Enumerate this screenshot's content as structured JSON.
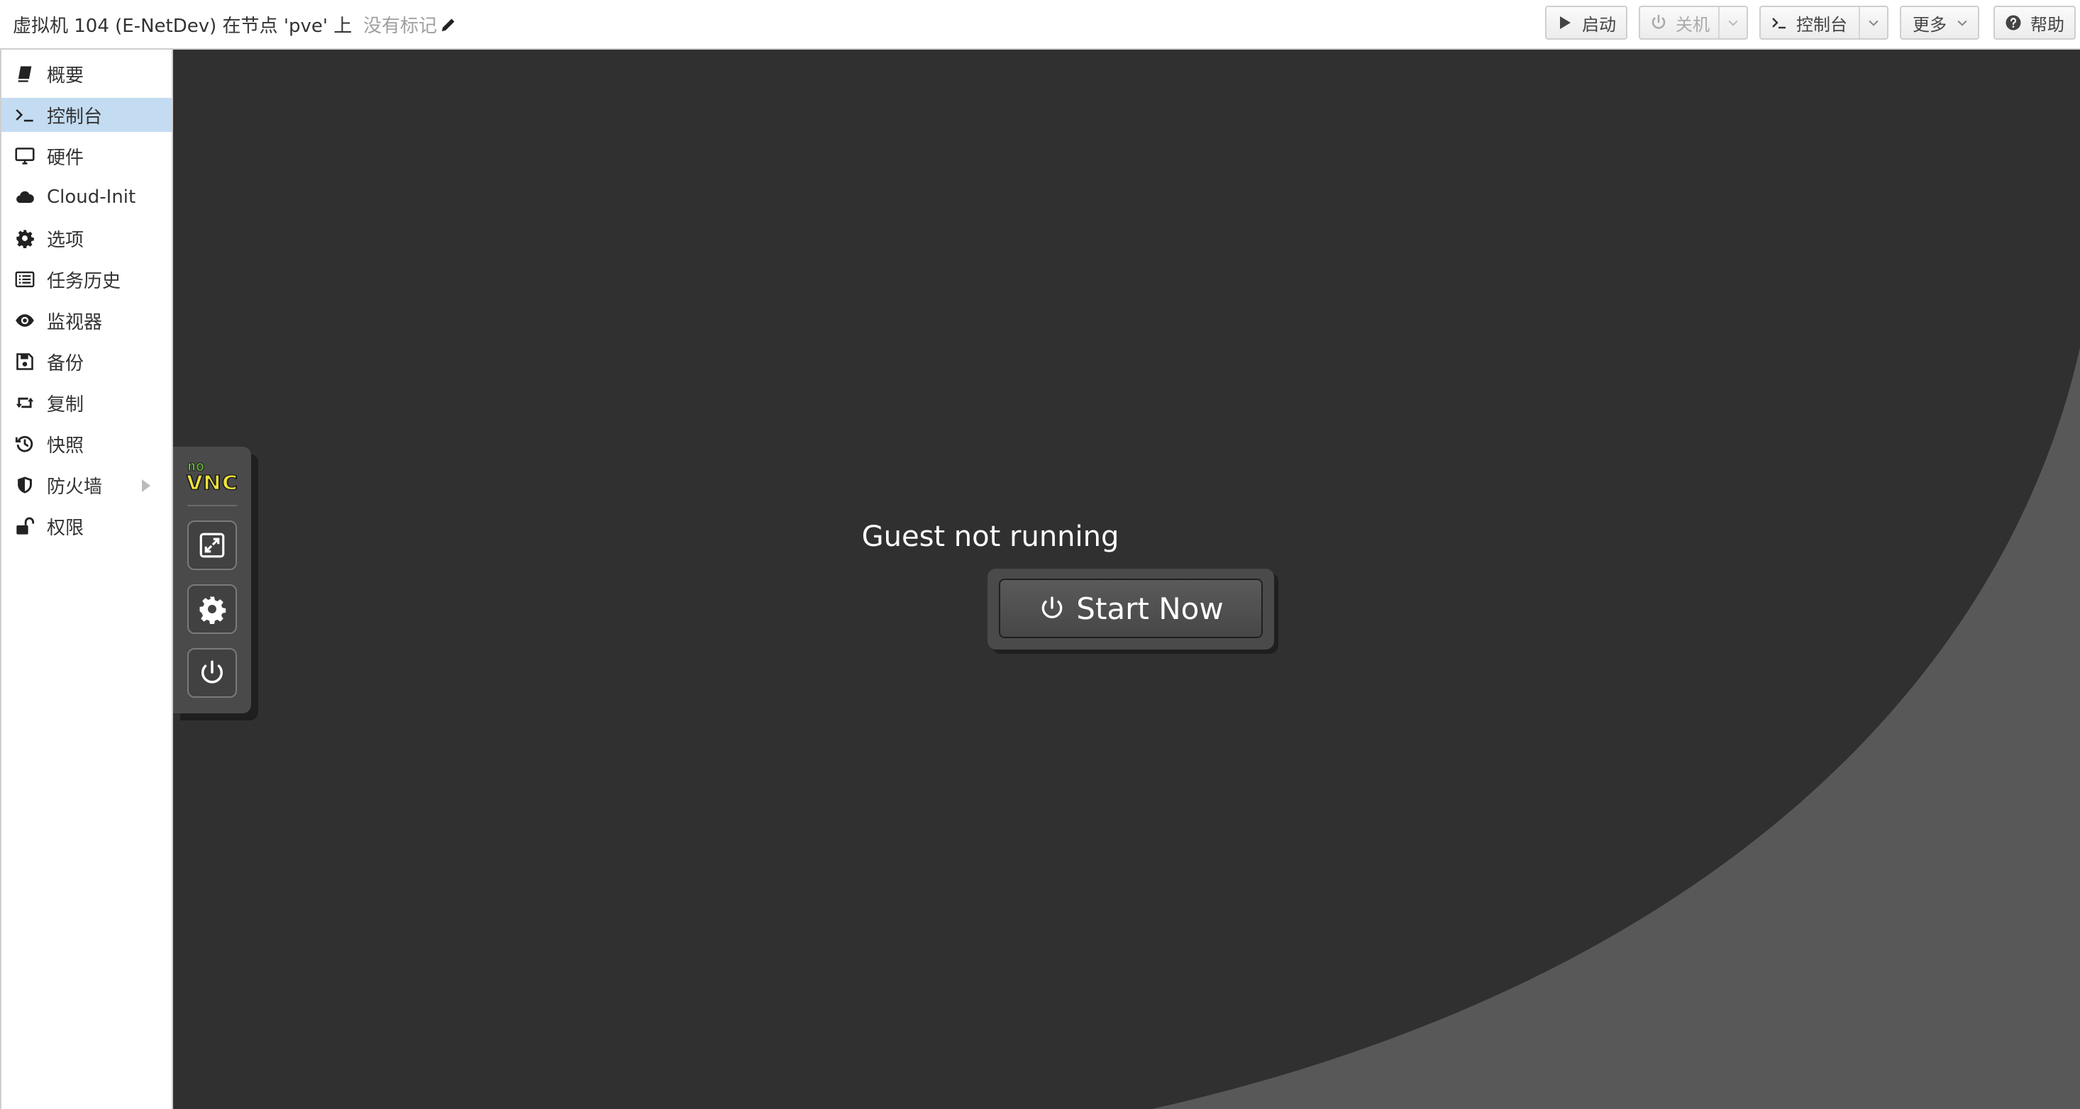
{
  "header": {
    "title": "虚拟机 104 (E-NetDev) 在节点 'pve' 上",
    "tags_placeholder": "没有标记",
    "tags_icon": "pencil-icon",
    "buttons": {
      "start": {
        "label": "启动",
        "icon": "play-icon"
      },
      "shutdown": {
        "label": "关机",
        "icon": "power-icon"
      },
      "console": {
        "label": "控制台",
        "icon": "terminal-icon"
      },
      "more": {
        "label": "更多",
        "icon": "chevron-down-icon"
      },
      "help": {
        "label": "帮助",
        "icon": "question-circle-icon"
      }
    }
  },
  "sidebar": {
    "active": "控制台",
    "items": [
      {
        "label": "概要",
        "icon": "book-icon"
      },
      {
        "label": "控制台",
        "icon": "terminal-icon"
      },
      {
        "label": "硬件",
        "icon": "monitor-icon"
      },
      {
        "label": "Cloud-Init",
        "icon": "cloud-icon"
      },
      {
        "label": "选项",
        "icon": "gear-icon"
      },
      {
        "label": "任务历史",
        "icon": "list-icon"
      },
      {
        "label": "监视器",
        "icon": "eye-icon"
      },
      {
        "label": "备份",
        "icon": "floppy-icon"
      },
      {
        "label": "复制",
        "icon": "retweet-icon"
      },
      {
        "label": "快照",
        "icon": "history-icon"
      },
      {
        "label": "防火墙",
        "icon": "shield-icon"
      },
      {
        "label": "权限",
        "icon": "unlock-icon"
      }
    ]
  },
  "console": {
    "logo_top": "no",
    "logo_bottom": "VNC",
    "controls": [
      "fullscreen-icon",
      "gear-icon",
      "power-icon"
    ],
    "status": "Guest not running",
    "start_button": "Start Now"
  },
  "colors": {
    "active_nav": "#c4dcf2",
    "console_bg": "#303030",
    "novnc_green": "#6ec43a",
    "novnc_yellow": "#f0e23c"
  }
}
